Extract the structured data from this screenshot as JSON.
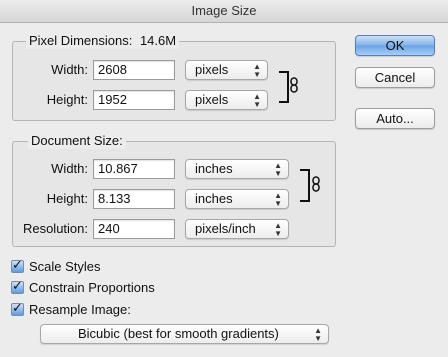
{
  "window": {
    "title": "Image Size"
  },
  "pixel_dimensions": {
    "legend": "Pixel Dimensions:",
    "size_value": "14.6M",
    "width": {
      "label": "Width:",
      "value": "2608",
      "unit": "pixels"
    },
    "height": {
      "label": "Height:",
      "value": "1952",
      "unit": "pixels"
    }
  },
  "document_size": {
    "legend": "Document Size:",
    "width": {
      "label": "Width:",
      "value": "10.867",
      "unit": "inches"
    },
    "height": {
      "label": "Height:",
      "value": "8.133",
      "unit": "inches"
    },
    "resolution": {
      "label": "Resolution:",
      "value": "240",
      "unit": "pixels/inch"
    }
  },
  "options": {
    "scale_styles": {
      "label": "Scale Styles",
      "checked": true
    },
    "constrain_proportions": {
      "label": "Constrain Proportions",
      "checked": true
    },
    "resample_image": {
      "label": "Resample Image:",
      "checked": true
    },
    "resample_method": "Bicubic (best for smooth gradients)"
  },
  "buttons": {
    "ok": "OK",
    "cancel": "Cancel",
    "auto": "Auto..."
  },
  "colors": {
    "default_button": "#6aa3e6",
    "checkbox": "#5d9be2"
  }
}
